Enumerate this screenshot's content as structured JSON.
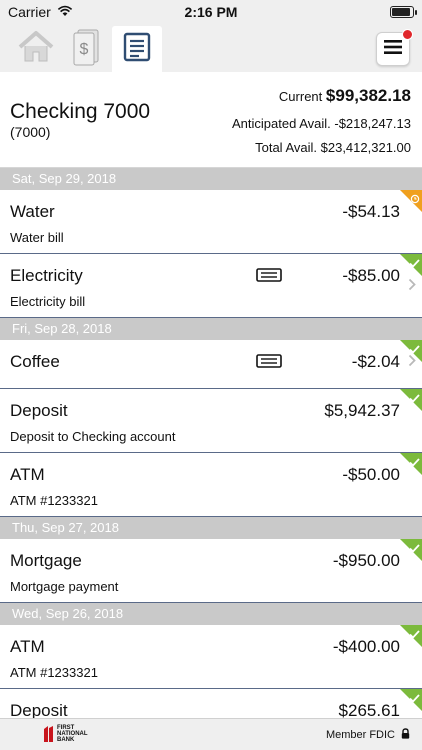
{
  "status": {
    "carrier": "Carrier",
    "time": "2:16 PM"
  },
  "account": {
    "name": "Checking 7000",
    "number": "(7000)",
    "current_label": "Current",
    "current_value": "$99,382.18",
    "anticipated": "Anticipated Avail. -$218,247.13",
    "total": "Total Avail. $23,412,321.00"
  },
  "groups": [
    {
      "date": "Sat, Sep 29, 2018"
    },
    {
      "date": "Fri, Sep 28, 2018"
    },
    {
      "date": "Thu, Sep 27, 2018"
    },
    {
      "date": "Wed, Sep 26, 2018"
    }
  ],
  "transactions": [
    {
      "name": "Water",
      "amount": "-$54.13",
      "desc": "Water bill",
      "status": "pending"
    },
    {
      "name": "Electricity",
      "amount": "-$85.00",
      "desc": "Electricity bill",
      "status": "cleared",
      "has_memo": true
    },
    {
      "name": "Coffee",
      "amount": "-$2.04",
      "desc": "",
      "status": "cleared",
      "has_memo": true
    },
    {
      "name": "Deposit",
      "amount": "$5,942.37",
      "desc": "Deposit to Checking account",
      "status": "cleared"
    },
    {
      "name": "ATM",
      "amount": "-$50.00",
      "desc": "ATM #1233321",
      "status": "cleared"
    },
    {
      "name": "Mortgage",
      "amount": "-$950.00",
      "desc": "Mortgage payment",
      "status": "cleared"
    },
    {
      "name": "ATM",
      "amount": "-$400.00",
      "desc": "ATM #1233321",
      "status": "cleared"
    },
    {
      "name": "Deposit",
      "amount": "$265.61",
      "desc": "",
      "status": "cleared"
    }
  ],
  "footer": {
    "logo_text_1": "FIRST",
    "logo_text_2": "NATIONAL",
    "logo_text_3": "BANK",
    "fdic": "Member FDIC"
  },
  "colors": {
    "cleared": "#7cba3c",
    "pending": "#f0a01e",
    "date_header": "#c9c9c9",
    "divider": "#5a6a88"
  },
  "icons": [
    "wifi-icon",
    "battery-icon",
    "home-icon",
    "money-icon",
    "statement-icon",
    "menu-icon",
    "memo-icon",
    "chevron-right-icon",
    "check-icon",
    "clock-icon",
    "lock-icon"
  ]
}
